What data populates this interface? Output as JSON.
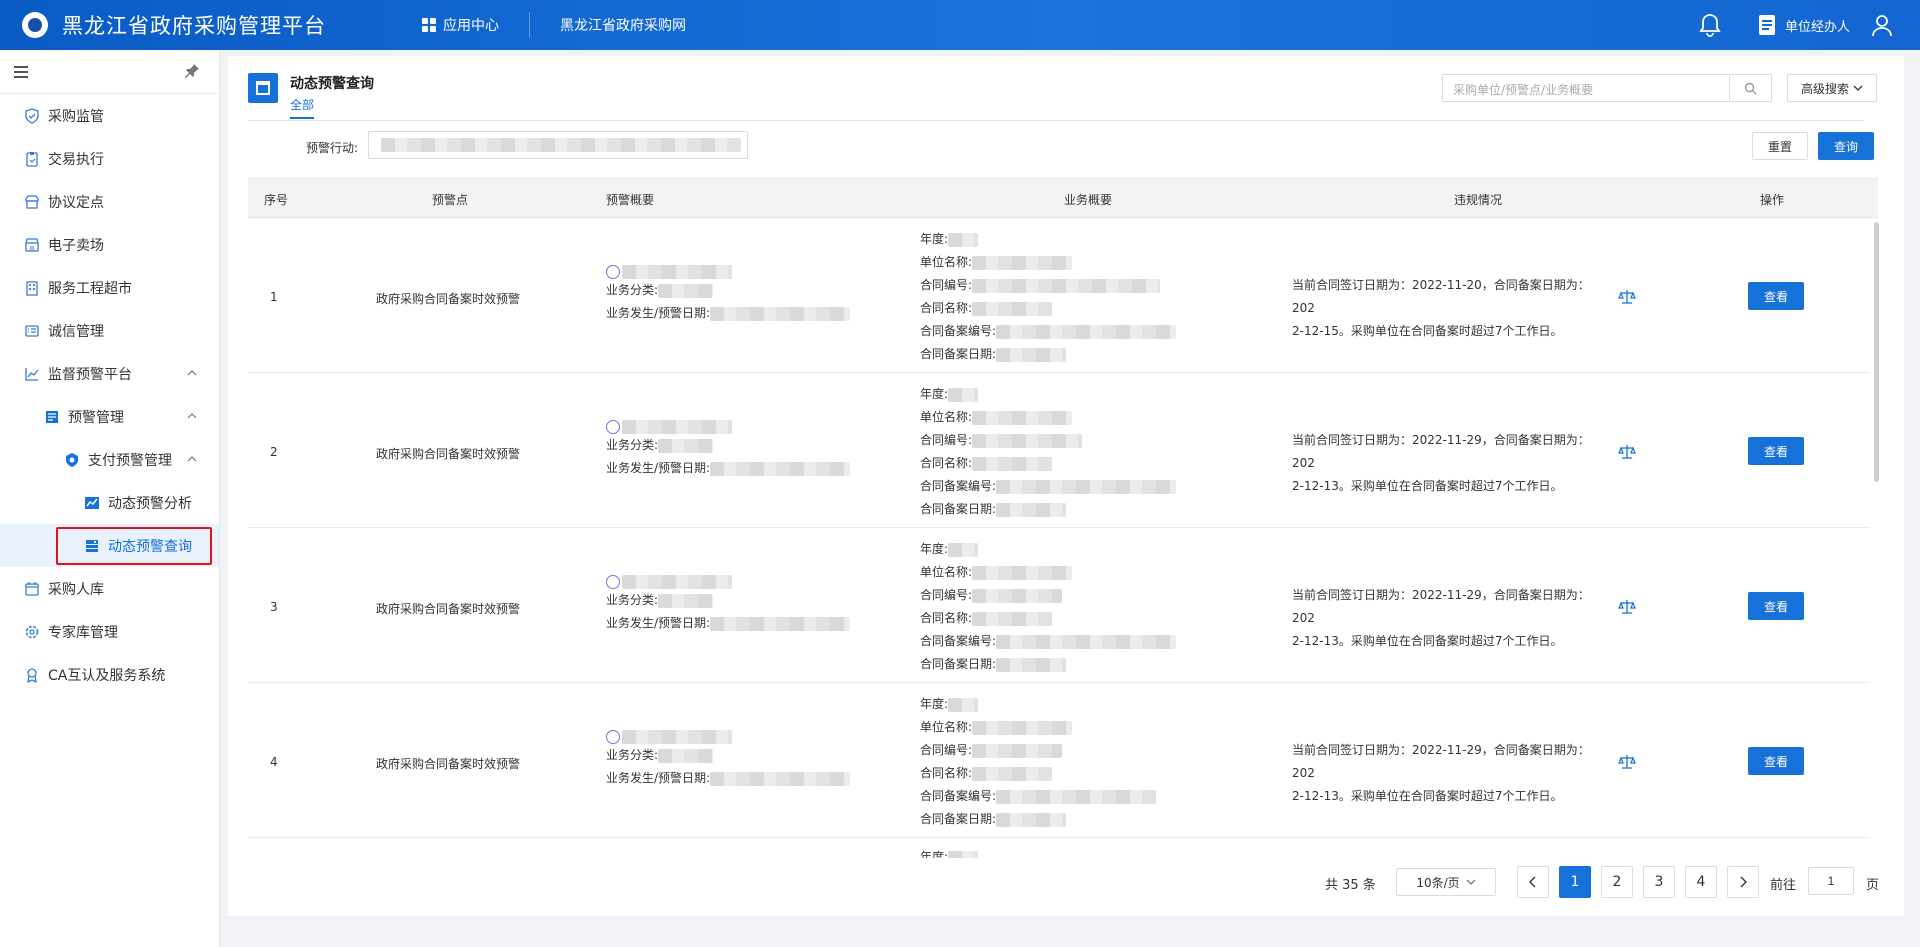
{
  "header": {
    "title": "黑龙江省政府采购管理平台",
    "app_center": "应用中心",
    "site_link": "黑龙江省政府采购网",
    "user_role": "单位经办人"
  },
  "sidebar": {
    "items": [
      {
        "label": "采购监管"
      },
      {
        "label": "交易执行"
      },
      {
        "label": "协议定点"
      },
      {
        "label": "电子卖场"
      },
      {
        "label": "服务工程超市"
      },
      {
        "label": "诚信管理"
      },
      {
        "label": "监督预警平台"
      },
      {
        "label": "预警管理"
      },
      {
        "label": "支付预警管理"
      },
      {
        "label": "动态预警分析"
      },
      {
        "label": "动态预警查询"
      },
      {
        "label": "采购人库"
      },
      {
        "label": "专家库管理"
      },
      {
        "label": "CA互认及服务系统"
      }
    ]
  },
  "page": {
    "title": "动态预警查询",
    "tab": "全部",
    "search_placeholder": "采购单位/预警点/业务概要",
    "advanced_search": "高级搜索",
    "filter_label": "预警行动:",
    "reset": "重置",
    "query": "查询"
  },
  "table": {
    "columns": [
      "序号",
      "预警点",
      "预警概要",
      "业务概要",
      "违规情况",
      "操作"
    ],
    "labels": {
      "biz_category": "业务分类:",
      "biz_date": "业务发生/预警日期:",
      "year": "年度:",
      "unit_name": "单位名称:",
      "contract_no": "合同编号:",
      "contract_name": "合同名称:",
      "filing_no": "合同备案编号:",
      "filing_date": "合同备案日期:"
    },
    "rows": [
      {
        "seq": "1",
        "point": "政府采购合同备案时效预警",
        "violation_line1": "当前合同签订日期为：2022-11-20，合同备案日期为：202",
        "violation_line2": "2-12-15。采购单位在合同备案时超过7个工作日。",
        "action": "查看"
      },
      {
        "seq": "2",
        "point": "政府采购合同备案时效预警",
        "violation_line1": "当前合同签订日期为：2022-11-29，合同备案日期为：202",
        "violation_line2": "2-12-13。采购单位在合同备案时超过7个工作日。",
        "action": "查看"
      },
      {
        "seq": "3",
        "point": "政府采购合同备案时效预警",
        "violation_line1": "当前合同签订日期为：2022-11-29，合同备案日期为：202",
        "violation_line2": "2-12-13。采购单位在合同备案时超过7个工作日。",
        "action": "查看"
      },
      {
        "seq": "4",
        "point": "政府采购合同备案时效预警",
        "violation_line1": "当前合同签订日期为：2022-11-29，合同备案日期为：202",
        "violation_line2": "2-12-13。采购单位在合同备案时超过7个工作日。",
        "action": "查看"
      }
    ]
  },
  "pagination": {
    "total": "共 35 条",
    "page_size": "10条/页",
    "pages": [
      "1",
      "2",
      "3",
      "4"
    ],
    "current": "1",
    "goto_label": "前往",
    "goto_value": "1",
    "unit": "页"
  },
  "colors": {
    "primary": "#1672d8",
    "header_bg": "#0a5bc4",
    "highlight_border": "#e0151b"
  }
}
